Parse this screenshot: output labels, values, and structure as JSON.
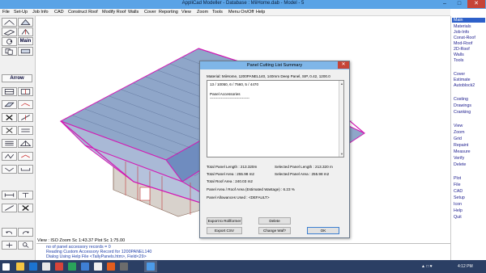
{
  "window": {
    "title": "AppliCad Modeller  -  Database : MiiHome.dab - Model - 5"
  },
  "menu": [
    "File",
    "Set-Up",
    "Job Info",
    "CAD",
    "Construct Roof",
    "Modify Roof",
    "Walls",
    "Cover",
    "Reporting",
    "View",
    "Zoom",
    "Tools",
    "Menu On/Off",
    "Help"
  ],
  "left_toolbar": {
    "main_label": "Main",
    "arrow_label": "Arrow"
  },
  "right_panel": {
    "items": [
      "Main",
      "Materials",
      "Job-Info",
      "Const-Roof",
      "Mod-Roof",
      "2D-Roof",
      "Walls",
      "Tools",
      "Cover",
      "Estimate",
      "Autoblock2",
      "Costing",
      "Drawings",
      "Cranking",
      "View",
      "Zoom",
      "Grid",
      "Repaint",
      "Measure",
      "Verify",
      "Delete",
      "Plot",
      "File",
      "CAD",
      "Setup",
      "Icon",
      "Help",
      "Quit"
    ],
    "selected": "Main"
  },
  "viewport": {
    "status": "View : ISO  Zoom Sc 1:43.37  Plot Sc 1:75.00"
  },
  "messages": [
    "no of panel accessory records = 0",
    "Reading Custom Accessory Record for 1200PANEL140",
    "Dialog Using Help File <TallyPanels.htm>, Field<29>"
  ],
  "dialog": {
    "title": "Panel Cutting List Summary",
    "material": "Material: MiiHome, 1200PANEL140, 140mm Deep Panel, SIP, 0.42, 1200.0",
    "list_line1": "13 / 10050,   6 / 7560,   5 / 4470",
    "list_line2": "Panel Accessories",
    "list_line3": "--------------------------------",
    "total_panel_length": "Total Panel Length : 213.320m",
    "selected_panel_length": "Selected Panel Length : 213.320 m",
    "total_panel_area": "Total Panel Area : 255.98 m2",
    "selected_panel_area": "Selected Panel Area : 255.98 m2",
    "total_roof_area": "Total Roof Area : 240.03 m2",
    "panel_roof_area": "Panel Area / Roof Area (Estimated Wastage) : 6.23 %",
    "allowances": "Panel Allowances Used : <DEFAULT>",
    "buttons": {
      "export_rollformer": "Export to Rollformer",
      "delete": "Delete",
      "export_csv": "Export CSV",
      "change_waf": "Change Waf?",
      "ok": "OK"
    }
  },
  "taskbar": {
    "time": "4:12 PM"
  },
  "colors": {
    "titlebar": "#5aa3e6",
    "panel_fill": "#8fa6c9",
    "outline": "#d21ab4",
    "taskbar": "#2b3f64",
    "selection": "#2d60c9"
  }
}
